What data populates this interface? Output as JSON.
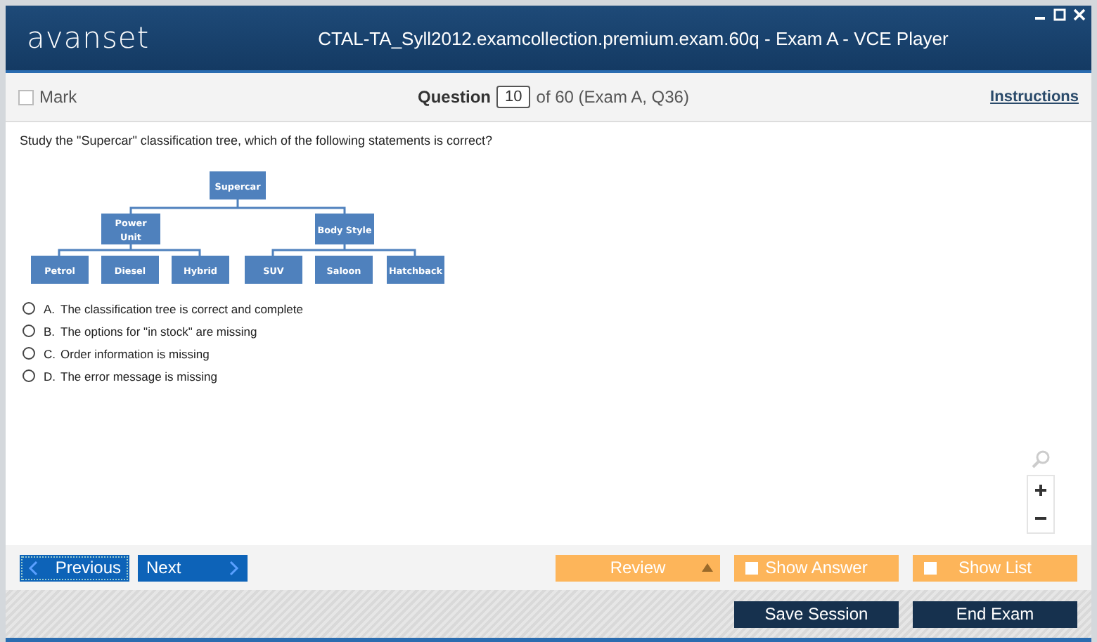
{
  "window": {
    "logo": "avanset",
    "title": "CTAL-TA_Syll2012.examcollection.premium.exam.60q - Exam A - VCE Player"
  },
  "toolbar": {
    "mark": {
      "label": "Mark",
      "checked": false
    },
    "question_label": "Question",
    "question_number": "10",
    "question_of": "of 60 (Exam A, Q36)",
    "instructions": "Instructions"
  },
  "question": {
    "text": "Study the \"Supercar\" classification tree, which of the following statements is correct?",
    "tree": {
      "label": "Supercar",
      "children": [
        {
          "label": "Power Unit",
          "children": [
            {
              "label": "Petrol"
            },
            {
              "label": "Diesel"
            },
            {
              "label": "Hybrid"
            }
          ]
        },
        {
          "label": "Body Style",
          "children": [
            {
              "label": "SUV"
            },
            {
              "label": "Saloon"
            },
            {
              "label": "Hatchback"
            }
          ]
        }
      ]
    },
    "options": [
      {
        "letter": "A.",
        "text": "The classification tree is correct and complete",
        "selected": false
      },
      {
        "letter": "B.",
        "text": "The options for \"in stock\" are missing",
        "selected": false
      },
      {
        "letter": "C.",
        "text": "Order information is missing",
        "selected": false
      },
      {
        "letter": "D.",
        "text": "The error message is missing",
        "selected": false
      }
    ]
  },
  "nav": {
    "previous": "Previous",
    "next": "Next",
    "review": "Review",
    "show_answer": {
      "label": "Show Answer",
      "checked": false
    },
    "show_list": {
      "label": "Show List",
      "checked": false
    }
  },
  "footer": {
    "save": "Save Session",
    "end": "End Exam"
  }
}
